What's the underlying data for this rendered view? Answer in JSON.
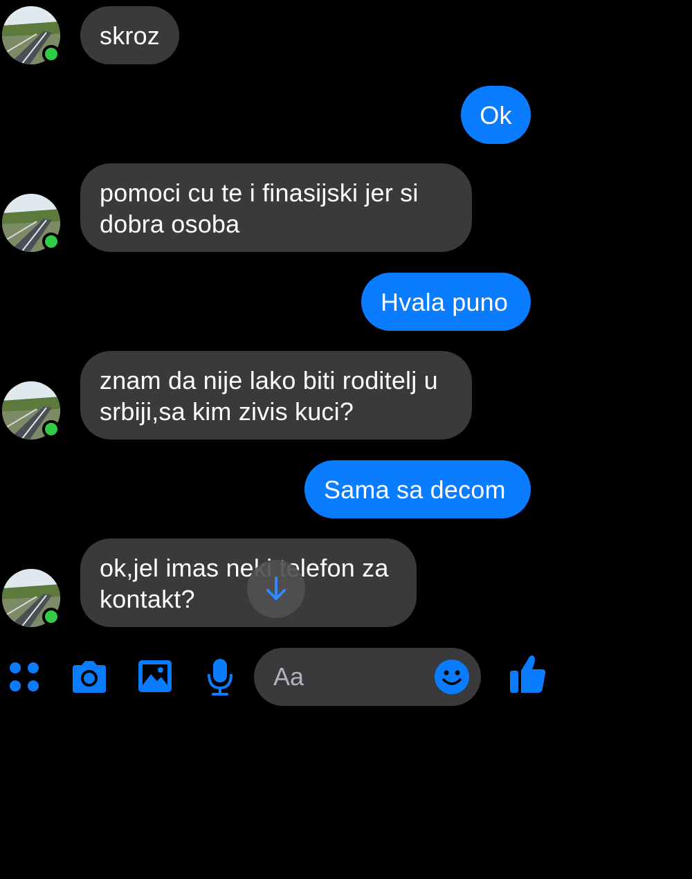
{
  "colors": {
    "background": "#000000",
    "incoming_bubble": "#3a3a3c",
    "outgoing_bubble": "#0a7cff",
    "accent": "#0a7cff",
    "online": "#31cc46"
  },
  "messages": [
    {
      "direction": "incoming",
      "lines": [
        "skroz"
      ],
      "avatar": true
    },
    {
      "direction": "outgoing",
      "lines": [
        "Ok"
      ]
    },
    {
      "direction": "incoming",
      "lines": [
        "pomoci cu te i finasijski jer si",
        "dobra osoba"
      ],
      "avatar": true
    },
    {
      "direction": "outgoing",
      "lines": [
        "Hvala puno"
      ]
    },
    {
      "direction": "incoming",
      "lines": [
        "znam da nije lako biti roditelj u",
        "srbiji,sa kim zivis kuci?"
      ],
      "avatar": true
    },
    {
      "direction": "outgoing",
      "lines": [
        "Sama sa decom"
      ]
    },
    {
      "direction": "incoming",
      "lines": [
        "ok,jel imas neki telefon za",
        "kontakt?"
      ],
      "avatar": true
    }
  ],
  "scroll_button": {
    "icon": "arrow-down-icon"
  },
  "composer": {
    "icons": [
      "menu-dots-icon",
      "camera-icon",
      "image-icon",
      "microphone-icon"
    ],
    "input_placeholder": "Aa",
    "emoji_icon": "smiley-icon",
    "like_icon": "thumbs-up-icon"
  }
}
